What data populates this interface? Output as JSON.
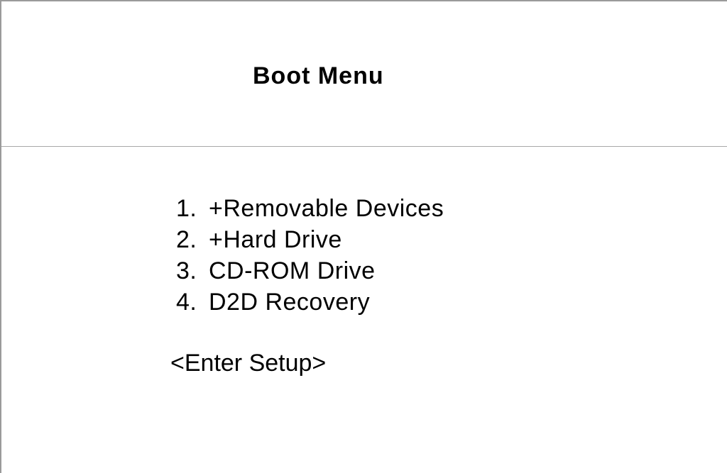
{
  "title": "Boot Menu",
  "menu": {
    "items": [
      {
        "number": "1.",
        "label": "+Removable Devices"
      },
      {
        "number": "2.",
        "label": "+Hard Drive"
      },
      {
        "number": "3.",
        "label": "CD-ROM Drive"
      },
      {
        "number": "4.",
        "label": "D2D Recovery"
      }
    ]
  },
  "setup_label": "<Enter Setup>",
  "colors": {
    "background": "#ffffff",
    "text": "#000000",
    "divider": "#a8a8a8"
  }
}
